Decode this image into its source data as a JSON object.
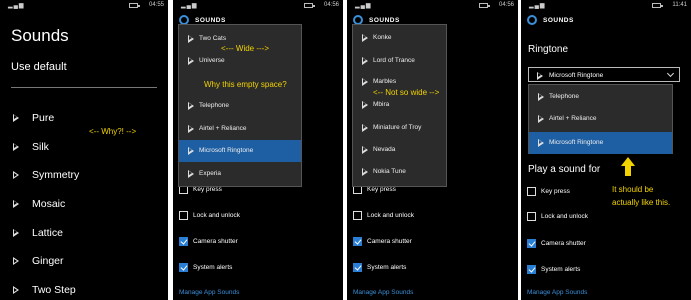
{
  "panel1": {
    "time": "04:55",
    "title": "Sounds",
    "use_default": "Use default",
    "items": [
      "Pure",
      "Silk",
      "Symmetry",
      "Mosaic",
      "Lattice",
      "Ginger",
      "Two Step"
    ],
    "annotation": "<-- Why?! -->"
  },
  "panel2": {
    "time": "04:56",
    "header": "SOUNDS",
    "options": [
      "Two Cats",
      "Universe",
      "Telephone",
      "Airtel + Reliance",
      "Microsoft Ringtone",
      "Experia"
    ],
    "selected_option": "Microsoft Ringtone",
    "annotation_wide": "<--- Wide --->",
    "annotation_empty": "Why this empty space?",
    "checkboxes": [
      {
        "label": "Key press",
        "checked": false
      },
      {
        "label": "Lock and unlock",
        "checked": false
      },
      {
        "label": "Camera shutter",
        "checked": true
      },
      {
        "label": "System alerts",
        "checked": true
      }
    ],
    "manage_link": "Manage App Sounds"
  },
  "panel3": {
    "time": "04:56",
    "header": "SOUNDS",
    "options": [
      "Konke",
      "Lord of Trance",
      "Marbles",
      "Mbira",
      "Miniature of Troy",
      "Nevada",
      "Nokia Tune"
    ],
    "annotation": "<-- Not so wide -->",
    "checkboxes": [
      {
        "label": "Key press",
        "checked": false
      },
      {
        "label": "Lock and unlock",
        "checked": false
      },
      {
        "label": "Camera shutter",
        "checked": true
      },
      {
        "label": "System alerts",
        "checked": true
      }
    ],
    "manage_link": "Manage App Sounds"
  },
  "panel4": {
    "time": "11:41",
    "header": "SOUNDS",
    "ringtone_label": "Ringtone",
    "combo_value": "Microsoft Ringtone",
    "options": [
      "Telephone",
      "Airtel + Reliance",
      "Microsoft Ringtone"
    ],
    "selected_option": "Microsoft Ringtone",
    "play_sound_label": "Play a sound for",
    "note_line1": "It should be",
    "note_line2": "actually like this.",
    "checkboxes": [
      {
        "label": "Key press",
        "checked": false
      },
      {
        "label": "Lock and unlock",
        "checked": false
      },
      {
        "label": "Camera shutter",
        "checked": true
      },
      {
        "label": "System alerts",
        "checked": true
      }
    ],
    "manage_link": "Manage App Sounds"
  },
  "colors": {
    "accent": "#1e5fa3",
    "annotation": "#f2d300",
    "link": "#3b8fd9"
  }
}
